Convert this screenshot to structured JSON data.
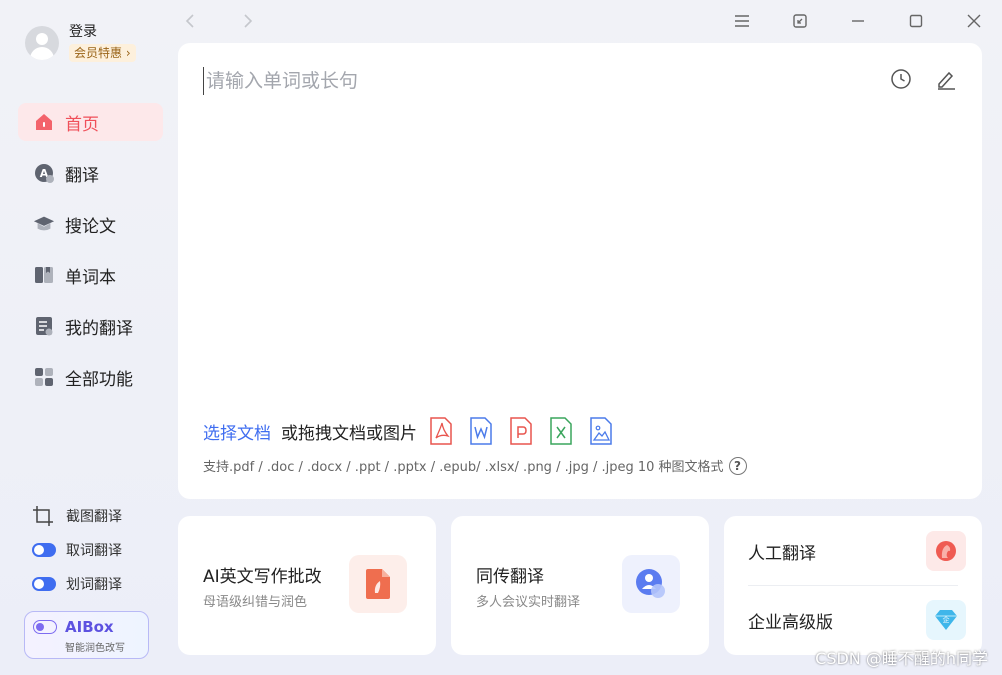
{
  "user": {
    "login_label": "登录",
    "vip_label": "会员特惠 ›"
  },
  "nav": {
    "items": [
      {
        "label": "首页",
        "icon": "home-icon"
      },
      {
        "label": "翻译",
        "icon": "translate-icon"
      },
      {
        "label": "搜论文",
        "icon": "graduation-cap-icon"
      },
      {
        "label": "单词本",
        "icon": "wordbook-icon"
      },
      {
        "label": "我的翻译",
        "icon": "document-icon"
      },
      {
        "label": "全部功能",
        "icon": "grid-icon"
      }
    ],
    "active_index": 0
  },
  "tools": {
    "screenshot_translate": "截图翻译",
    "word_pick_translate": "取词翻译",
    "select_translate": "划词翻译"
  },
  "aibox": {
    "title": "AIBox",
    "subtitle": "智能润色改写"
  },
  "search": {
    "placeholder": "请输入单词或长句"
  },
  "upload": {
    "link_label": "选择文档",
    "text": "或拖拽文档或图片",
    "file_types": [
      "pdf",
      "word",
      "ppt",
      "excel",
      "image"
    ],
    "formats_text": "支持.pdf / .doc / .docx / .ppt / .pptx / .epub/ .xlsx/ .png / .jpg / .jpeg  10 种图文格式"
  },
  "features": {
    "ai_writing": {
      "title": "AI英文写作批改",
      "subtitle": "母语级纠错与润色"
    },
    "simultaneous": {
      "title": "同传翻译",
      "subtitle": "多人会议实时翻译"
    },
    "human_translate": {
      "title": "人工翻译"
    },
    "enterprise": {
      "title": "企业高级版"
    }
  },
  "watermark": "CSDN @睡不醒的h同学",
  "colors": {
    "accent": "#3f6df0",
    "active_nav": "#f0505a",
    "brand_red": "#f0505a"
  }
}
